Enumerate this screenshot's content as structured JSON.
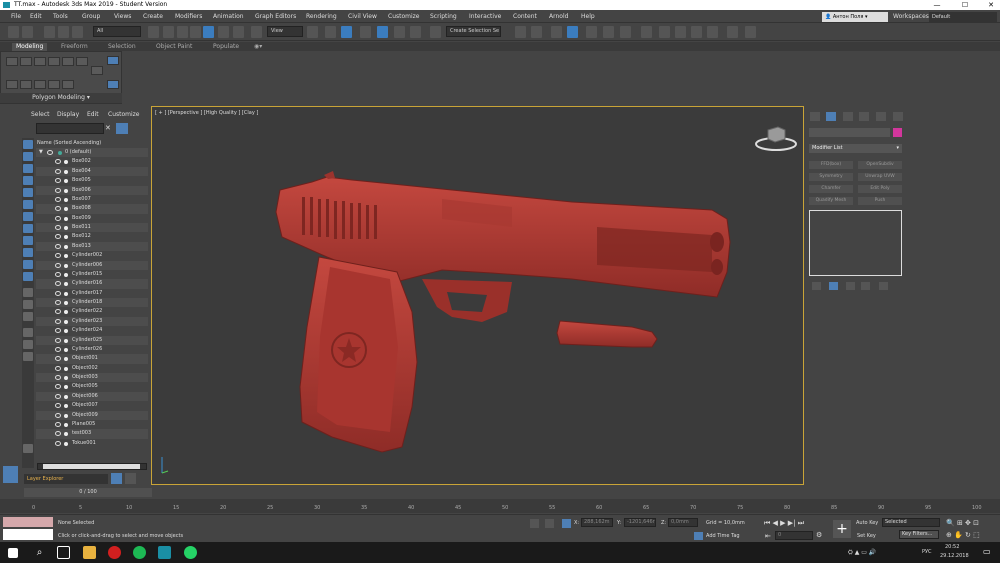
{
  "window": {
    "title": "TT.max - Autodesk 3ds Max 2019 - Student Version",
    "min": "—",
    "max": "☐",
    "close": "✕"
  },
  "menu": {
    "items": [
      "File",
      "Edit",
      "Tools",
      "Group",
      "Views",
      "Create",
      "Modifiers",
      "Animation",
      "Graph Editors",
      "Rendering",
      "Civil View",
      "Customize",
      "Scripting",
      "Interactive",
      "Content",
      "Arnold",
      "Help"
    ],
    "user": "Антон Поля",
    "workspaces_label": "Workspaces:",
    "workspace": "Default"
  },
  "toolbar": {
    "filter": "All",
    "view": "View",
    "selection_set": "Create Selection Se"
  },
  "ribbon": {
    "tabs": [
      "Modeling",
      "Freeform",
      "Selection",
      "Object Paint",
      "Populate"
    ],
    "panel_label": "Polygon Modeling ▾"
  },
  "scene_explorer": {
    "menu": [
      "Select",
      "Display",
      "Edit",
      "Customize"
    ],
    "header": "Name (Sorted Ascending)",
    "root": "0 (default)",
    "items": [
      "Box002",
      "Box004",
      "Box005",
      "Box006",
      "Box007",
      "Box008",
      "Box009",
      "Box011",
      "Box012",
      "Box013",
      "Cylinder002",
      "Cylinder006",
      "Cylinder015",
      "Cylinder016",
      "Cylinder017",
      "Cylinder018",
      "Cylinder022",
      "Cylinder023",
      "Cylinder024",
      "Cylinder025",
      "Cylinder026",
      "Object001",
      "Object002",
      "Object003",
      "Object005",
      "Object006",
      "Object007",
      "Object009",
      "Plane005",
      "test003",
      "Tokue001"
    ],
    "layer": "Layer Explorer"
  },
  "viewport": {
    "label": "[ + ] [Perspective ] [High Quality ] [Clay ]"
  },
  "command_panel": {
    "modifier_list": "Modifier List",
    "buttons": [
      "FFD(box)",
      "OpenSubdiv",
      "Symmetry",
      "Unwrap UVW",
      "Chamfer",
      "Edit Poly",
      "Quadify Mesh",
      "Push"
    ]
  },
  "timeline": {
    "counter": "0 / 100",
    "ticks": [
      "0",
      "5",
      "10",
      "15",
      "20",
      "25",
      "30",
      "35",
      "40",
      "45",
      "50",
      "55",
      "60",
      "65",
      "70",
      "75",
      "80",
      "85",
      "90",
      "95",
      "100"
    ]
  },
  "status": {
    "selection": "None Selected",
    "prompt": "Click or click-and-drag to select and move objects",
    "x_label": "X:",
    "x": "288,162m",
    "y_label": "Y:",
    "y": "-1201,646r",
    "z_label": "Z:",
    "z": "0,0mm",
    "grid": "Grid = 10,0mm",
    "add_time_tag": "Add Time Tag",
    "auto_key": "Auto Key",
    "selected": "Selected",
    "set_key": "Set Key",
    "key_filters": "Key Filters...",
    "frame": "0"
  },
  "taskbar": {
    "lang": "РУС",
    "time": "20:52",
    "date": "29.12.2018"
  },
  "colors": {
    "accent": "#3b7dbf",
    "viewport_border": "#c9a437",
    "model": "#b03a33",
    "swatch": "#d2369c"
  }
}
